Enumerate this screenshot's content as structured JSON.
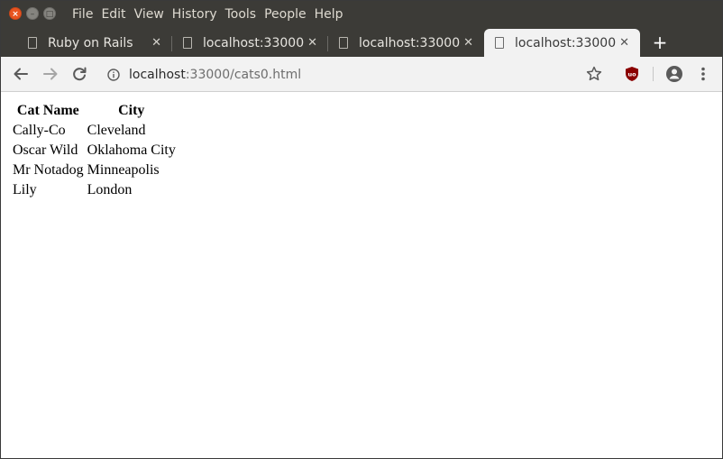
{
  "menu": [
    "File",
    "Edit",
    "View",
    "History",
    "Tools",
    "People",
    "Help"
  ],
  "tabs": [
    {
      "title": "Ruby on Rails",
      "close": "✕"
    },
    {
      "title": "localhost:33000/",
      "close": "✕"
    },
    {
      "title": "localhost:33000/",
      "close": "✕"
    },
    {
      "title": "localhost:33000/",
      "close": "✕"
    }
  ],
  "new_tab_label": "+",
  "address": {
    "host": "localhost",
    "path": ":33000/cats0.html"
  },
  "icons": {
    "back": "arrow-left",
    "forward": "arrow-right",
    "reload": "reload",
    "info": "info-circle",
    "bookmark": "star",
    "extension": "ublock-shield",
    "profile": "account-circle",
    "menu": "three-dots-vertical"
  },
  "colors": {
    "titlebar": "#3c3b37",
    "close_button": "#e95420",
    "toolbar": "#f2f2f2",
    "ublock": "#8b0000"
  },
  "page": {
    "headers": [
      "Cat Name",
      "City"
    ],
    "rows": [
      [
        "Cally-Co",
        "Cleveland"
      ],
      [
        "Oscar Wild",
        "Oklahoma City"
      ],
      [
        "Mr Notadog",
        "Minneapolis"
      ],
      [
        "Lily",
        "London"
      ]
    ]
  }
}
